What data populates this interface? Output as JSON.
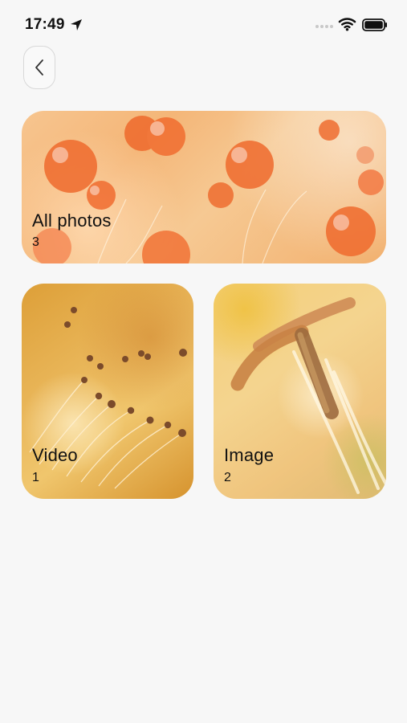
{
  "status_bar": {
    "time": "17:49"
  },
  "navigation": {
    "back_icon": "chevron-left"
  },
  "albums": [
    {
      "label": "All photos",
      "count": "3"
    },
    {
      "label": "Video",
      "count": "1"
    },
    {
      "label": "Image",
      "count": "2"
    }
  ]
}
